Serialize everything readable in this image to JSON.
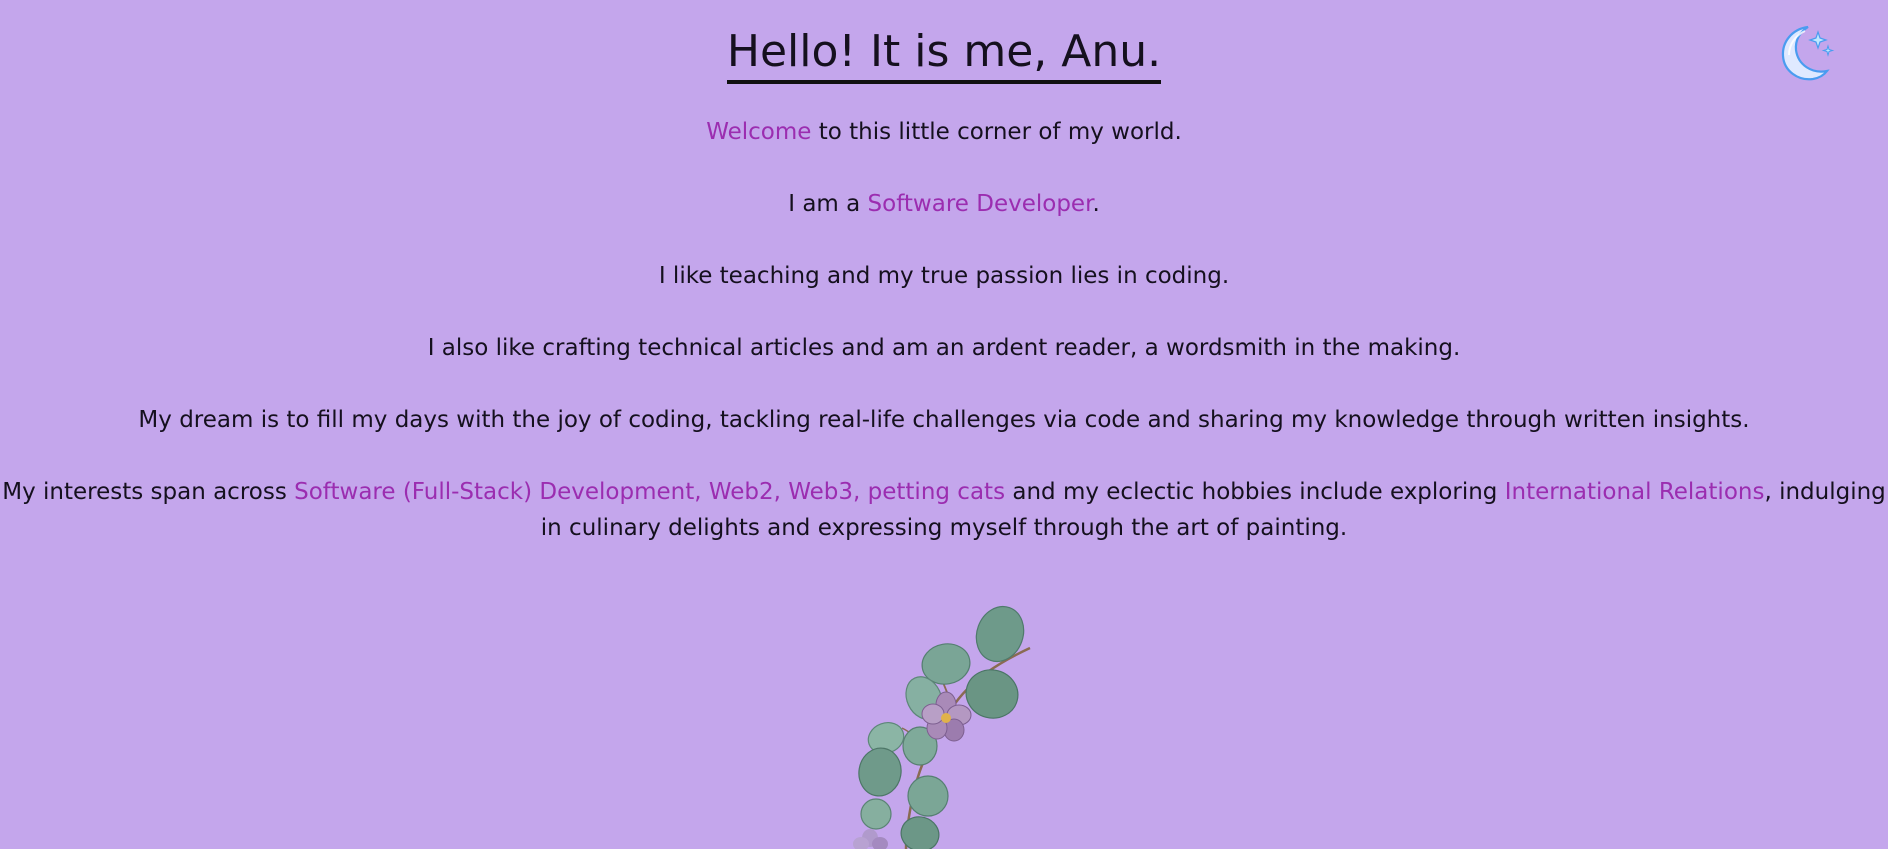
{
  "header": {
    "title": "Hello! It is me, Anu."
  },
  "theme_toggle": {
    "icon": "moon-stars-icon",
    "colors": {
      "moon": "#dfe9ff",
      "outline": "#4a9cf0",
      "stars": "#7fd0ff"
    }
  },
  "intro": {
    "welcome": {
      "highlight": "Welcome",
      "rest": " to this little corner of my world."
    },
    "role": {
      "prefix": "I am a ",
      "highlight": "Software Developer",
      "suffix": "."
    },
    "passion": "I like teaching and my true passion lies in coding.",
    "writing": "I also like crafting technical articles and am an ardent reader, a wordsmith in the making.",
    "dream": "My dream is to fill my days with the joy of coding, tackling real-life challenges via code and sharing my knowledge through written insights.",
    "interests": {
      "prefix": "My interests span across ",
      "highlight1": "Software (Full-Stack) Development, Web2, Web3, petting cats",
      "middle": " and my eclectic hobbies include exploring ",
      "highlight2": "International Relations",
      "suffix": ", indulging in culinary delights and expressing myself through the art of painting."
    }
  },
  "decoration": {
    "icon": "eucalyptus-flower-sprig-icon"
  },
  "colors": {
    "background": "#c4a6ec",
    "accent": "#9b2db0",
    "text": "#15101e"
  }
}
